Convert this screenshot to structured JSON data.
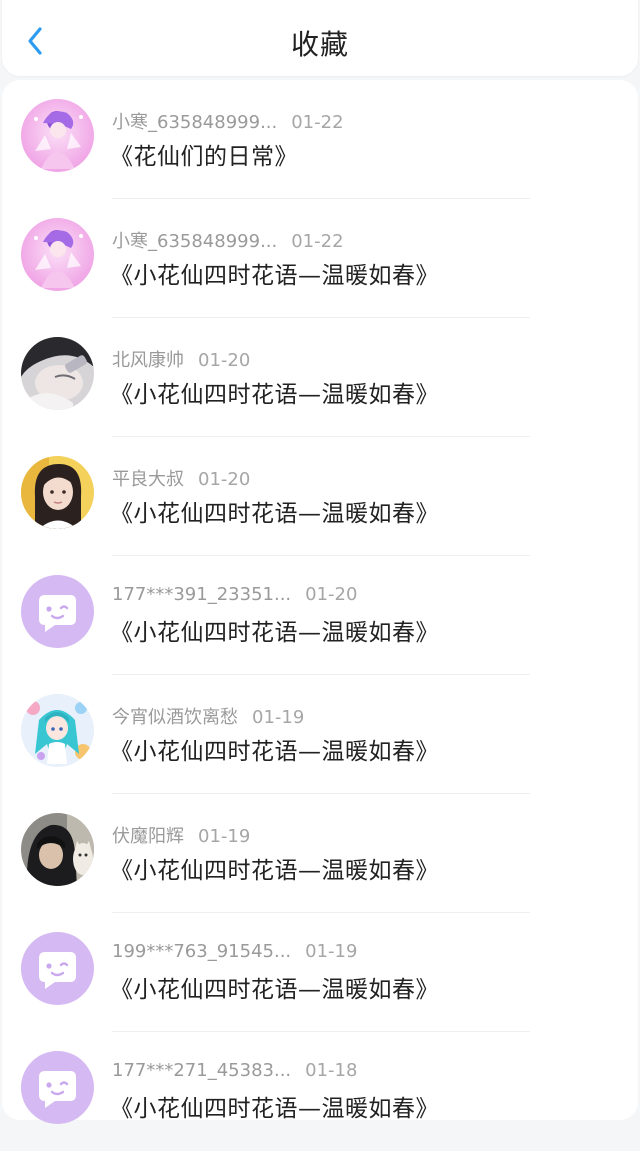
{
  "header": {
    "title": "收藏"
  },
  "favorites": [
    {
      "user": "小寒_635848999...",
      "date": "01-22",
      "title": "《花仙们的日常》",
      "avatar": "anime-fairy-pink"
    },
    {
      "user": "小寒_635848999...",
      "date": "01-22",
      "title": "《小花仙四时花语—温暖如春》",
      "avatar": "anime-fairy-pink"
    },
    {
      "user": "北风康帅",
      "date": "01-20",
      "title": "《小花仙四时花语—温暖如春》",
      "avatar": "photo-face-closeup"
    },
    {
      "user": "平良大叔",
      "date": "01-20",
      "title": "《小花仙四时花语—温暖如春》",
      "avatar": "photo-girl"
    },
    {
      "user": "177***391_23351...",
      "date": "01-20",
      "title": "《小花仙四时花语—温暖如春》",
      "avatar": "default-purple-chat"
    },
    {
      "user": "今宵似酒饮离愁",
      "date": "01-19",
      "title": "《小花仙四时花语—温暖如春》",
      "avatar": "anime-blue-girl"
    },
    {
      "user": "伏魔阳辉",
      "date": "01-19",
      "title": "《小花仙四时花语—温暖如春》",
      "avatar": "photo-hooded-cat"
    },
    {
      "user": "199***763_91545...",
      "date": "01-19",
      "title": "《小花仙四时花语—温暖如春》",
      "avatar": "default-purple-chat"
    },
    {
      "user": "177***271_45383...",
      "date": "01-18",
      "title": "《小花仙四时花语—温暖如春》",
      "avatar": "default-purple-chat"
    }
  ],
  "colors": {
    "accent": "#2d9cf0",
    "default_avatar": "#d5b9f3"
  }
}
